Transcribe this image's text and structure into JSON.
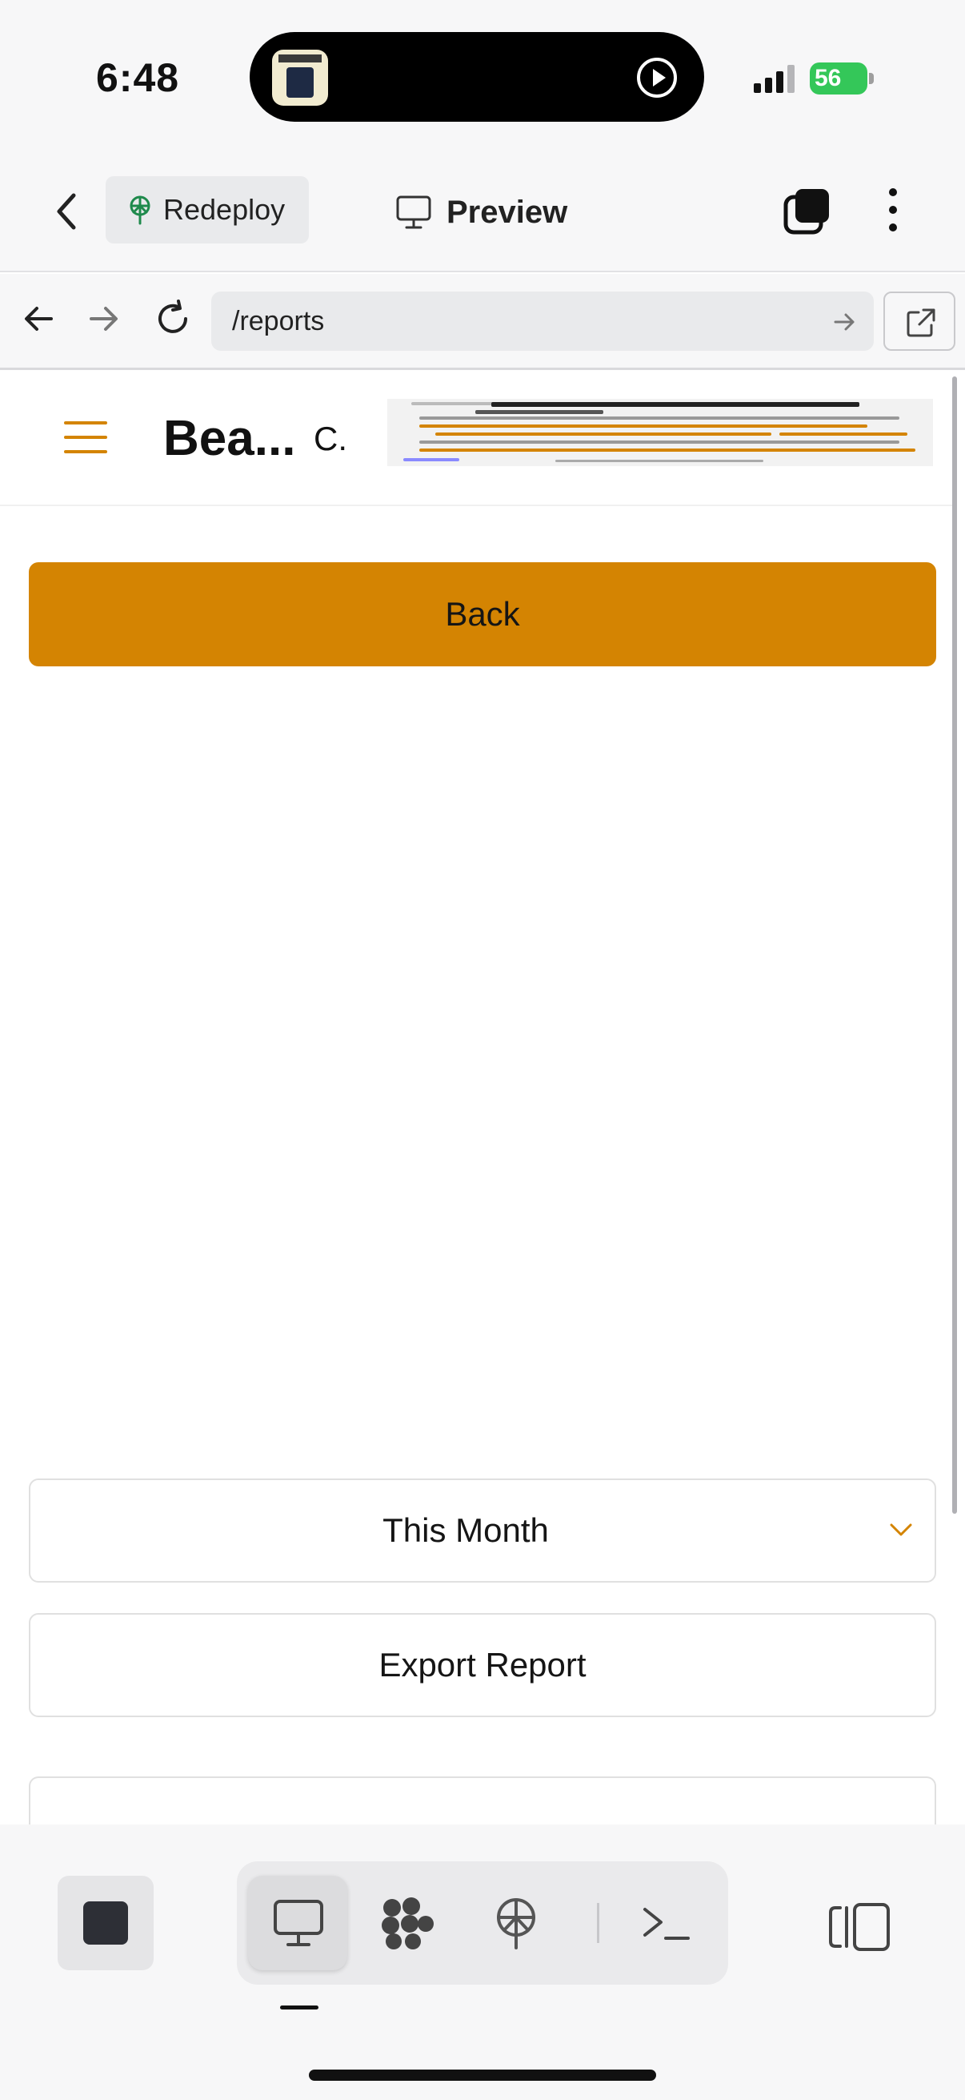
{
  "status_bar": {
    "time": "6:48",
    "battery_level": "56",
    "battery_color": "#34c759"
  },
  "header": {
    "redeploy_label": "Redeploy",
    "preview_label": "Preview"
  },
  "url_bar": {
    "path": "/reports"
  },
  "site": {
    "title": "Bea...",
    "subtitle_fragment": "C."
  },
  "main": {
    "back_label": "Back",
    "period_selected": "This Month",
    "export_label": "Export Report",
    "accent_color": "#d48402"
  },
  "icons": {
    "nav_back": "chevron-left-icon",
    "redeploy": "redeploy-icon",
    "preview": "monitor-icon",
    "tabs": "tabs-icon",
    "more": "more-vertical-icon",
    "browser_back": "arrow-left-icon",
    "browser_forward": "arrow-right-icon",
    "reload": "reload-icon",
    "go": "arrow-right-icon",
    "external": "external-link-icon",
    "menu": "hamburger-icon",
    "dropdown": "chevron-down-icon",
    "stop": "stop-icon",
    "toolbar": [
      "monitor-icon",
      "workflow-icon",
      "deploy-icon",
      "terminal-icon"
    ],
    "panel": "panel-toggle-icon"
  }
}
